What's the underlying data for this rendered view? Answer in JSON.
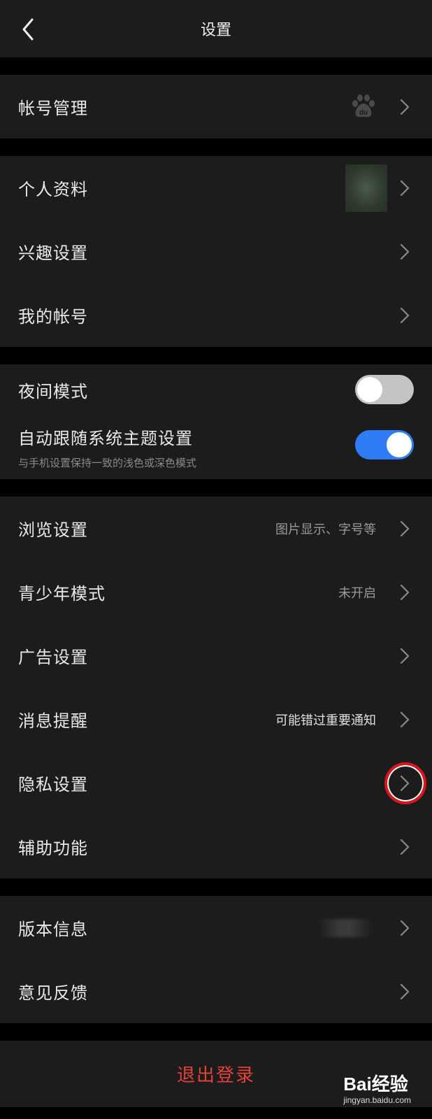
{
  "header": {
    "title": "设置"
  },
  "account_section": {
    "account_manage_label": "帐号管理"
  },
  "profile_section": {
    "items": [
      {
        "label": "个人资料"
      },
      {
        "label": "兴趣设置"
      },
      {
        "label": "我的帐号"
      }
    ]
  },
  "theme_section": {
    "night_mode": {
      "label": "夜间模式",
      "enabled": false
    },
    "auto_theme": {
      "label": "自动跟随系统主题设置",
      "sub": "与手机设置保持一致的浅色或深色模式",
      "enabled": true
    }
  },
  "settings_section": {
    "items": [
      {
        "label": "浏览设置",
        "value": "图片显示、字号等"
      },
      {
        "label": "青少年模式",
        "value": "未开启"
      },
      {
        "label": "广告设置",
        "value": ""
      },
      {
        "label": "消息提醒",
        "value": "可能错过重要通知"
      },
      {
        "label": "隐私设置",
        "value": ""
      },
      {
        "label": "辅助功能",
        "value": ""
      }
    ]
  },
  "about_section": {
    "items": [
      {
        "label": "版本信息"
      },
      {
        "label": "意见反馈"
      }
    ]
  },
  "logout": {
    "label": "退出登录"
  },
  "watermark": {
    "brand": "Bai经验",
    "url": "jingyan.baidu.com"
  },
  "colors": {
    "background": "#000000",
    "panel": "#1c1c1c",
    "toggle_on": "#2f7cf6",
    "logout_red": "#e4413b",
    "annotation_circle": "#d8141f"
  },
  "icons": {
    "back": "chevron-left-icon",
    "row_arrow": "chevron-right-icon",
    "baidu": "baidu-paw-icon"
  }
}
